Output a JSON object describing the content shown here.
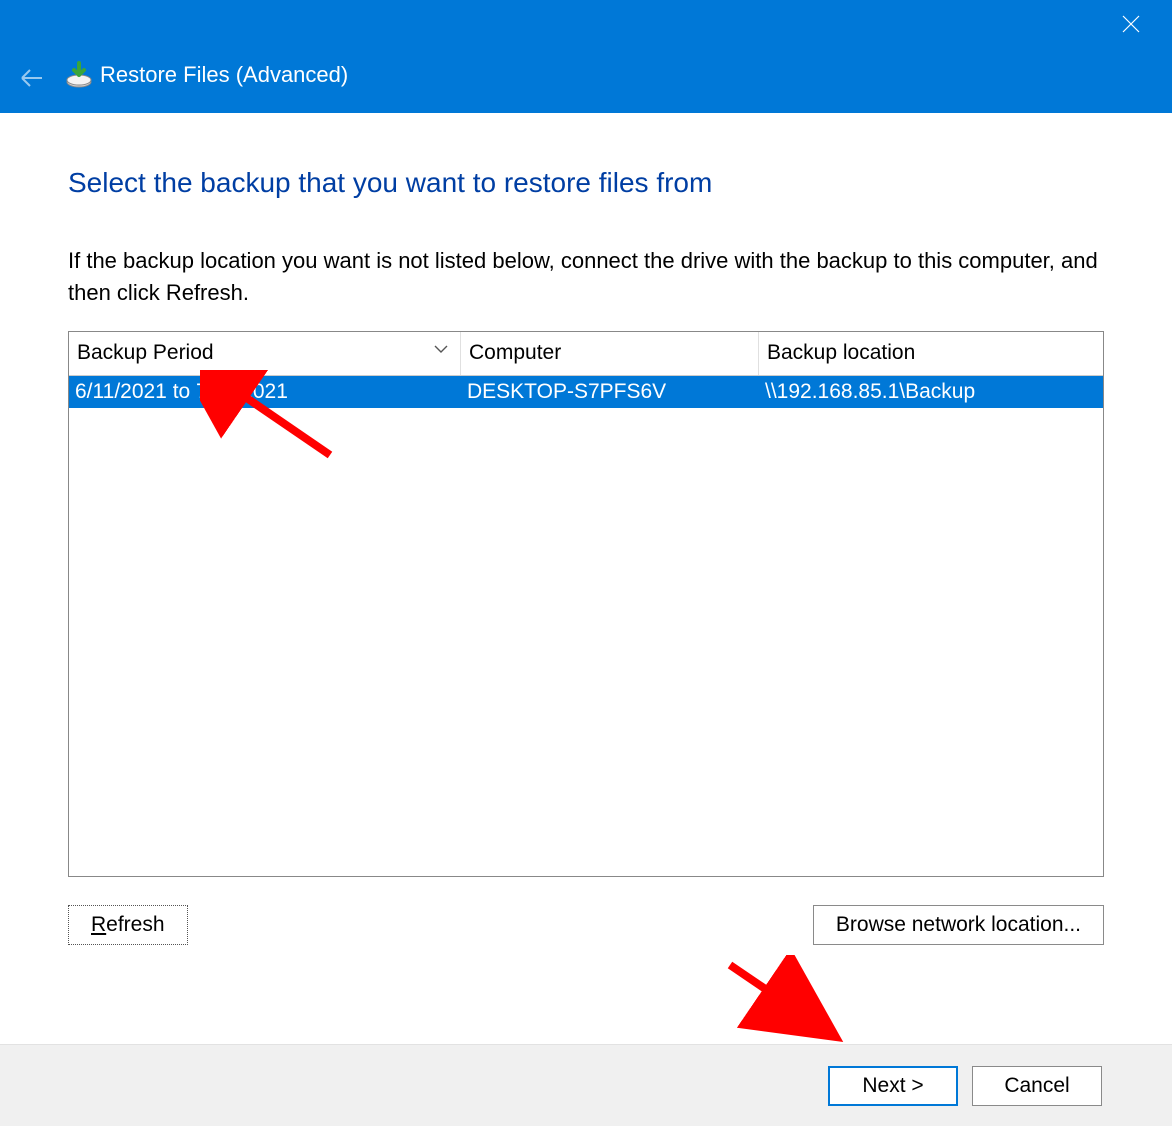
{
  "window": {
    "title": "Restore Files (Advanced)"
  },
  "page": {
    "heading": "Select the backup that you want to restore files from",
    "instructions": "If the backup location you want is not listed below, connect the drive with the backup to this computer, and then click Refresh."
  },
  "columns": {
    "period": "Backup Period",
    "computer": "Computer",
    "location": "Backup location"
  },
  "rows": [
    {
      "period": "6/11/2021 to 7/11/2021",
      "computer": "DESKTOP-S7PFS6V",
      "location": "\\\\192.168.85.1\\Backup",
      "selected": true
    }
  ],
  "buttons": {
    "refresh_prefix": "R",
    "refresh_rest": "efresh",
    "browse": "Browse network location...",
    "next": "Next >",
    "cancel": "Cancel"
  }
}
